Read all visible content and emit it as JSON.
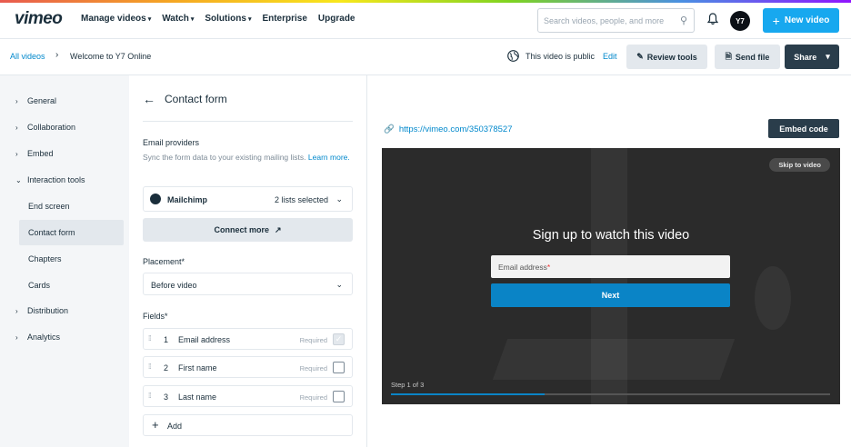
{
  "nav": {
    "logo": "vimeo",
    "links": [
      "Manage videos",
      "Watch",
      "Solutions",
      "Enterprise",
      "Upgrade"
    ],
    "search_placeholder": "Search videos, people, and more",
    "avatar_initials": "Y7",
    "new_video_label": "New video",
    "accent_color": "#17a8ef"
  },
  "subbar": {
    "breadcrumb_root": "All videos",
    "breadcrumb_current": "Welcome to Y7 Online",
    "visibility_text": "This video is public",
    "edit_label": "Edit",
    "review_tools_label": "Review tools",
    "send_file_label": "Send file",
    "share_label": "Share"
  },
  "sidebar": {
    "items": [
      {
        "label": "General"
      },
      {
        "label": "Collaboration"
      },
      {
        "label": "Embed"
      },
      {
        "label": "Interaction tools"
      },
      {
        "label": "End screen"
      },
      {
        "label": "Contact form"
      },
      {
        "label": "Chapters"
      },
      {
        "label": "Cards"
      },
      {
        "label": "Distribution"
      },
      {
        "label": "Analytics"
      }
    ]
  },
  "panel": {
    "title": "Contact form",
    "email_providers_heading": "Email providers",
    "email_providers_desc": "Sync the form data to your existing mailing lists.",
    "learn_more": "Learn more.",
    "provider_name": "Mailchimp",
    "provider_lists": "2 lists selected",
    "connect_more_label": "Connect more",
    "placement_label": "Placement*",
    "placement_value": "Before video",
    "fields_label": "Fields*",
    "fields": [
      {
        "num": "1",
        "name": "Email address",
        "required_label": "Required",
        "checked": true
      },
      {
        "num": "2",
        "name": "First name",
        "required_label": "Required",
        "checked": false
      },
      {
        "num": "3",
        "name": "Last name",
        "required_label": "Required",
        "checked": false
      }
    ],
    "add_label": "Add"
  },
  "preview": {
    "url": "https://vimeo.com/350378527",
    "embed_code_label": "Embed code",
    "skip_label": "Skip to video",
    "headline": "Sign up to watch this video",
    "email_placeholder": "Email address",
    "next_label": "Next",
    "step_text": "Step 1 of 3",
    "progress_fraction": 0.35
  }
}
